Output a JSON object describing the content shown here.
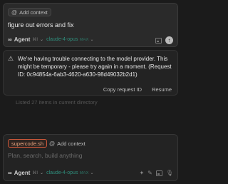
{
  "top_box": {
    "add_context": "Add context",
    "prompt": "figure out errors and fix",
    "agent_label": "Agent",
    "agent_shortcut": "⌘I",
    "model": "claude-4-opus",
    "model_shortcut": "MAX"
  },
  "error": {
    "message": "We're having trouble connecting to the model provider. This might be temporary - please try again in a moment. (Request ID: 0c94854a-6ab3-4620-a630-98d49032b2d1)",
    "copy_label": "Copy request ID",
    "resume_label": "Resume"
  },
  "faded_line": "Listed 27 items in current directory",
  "composer": {
    "file_chip": "supercode.sh",
    "add_context": "Add context",
    "placeholder": "Plan, search, build anything",
    "agent_label": "Agent",
    "agent_shortcut": "⌘I",
    "model": "claude-4-opus",
    "model_shortcut": "MAX"
  },
  "colors": {
    "background": "#1b1b1b",
    "model_accent": "#2f8f7d",
    "chip_border": "#c9573a"
  }
}
